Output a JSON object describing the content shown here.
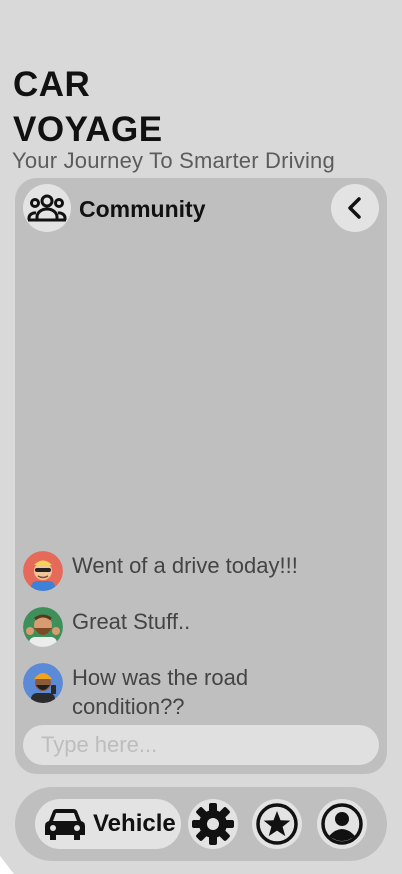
{
  "app": {
    "title_line1": "CAR",
    "title_line2": "VOYAGE",
    "tagline": "Your Journey To Smarter Driving"
  },
  "community": {
    "title": "Community",
    "messages": [
      {
        "text": "Went of a drive today!!!",
        "avatar": "avatar-sunglasses"
      },
      {
        "text": "Great Stuff..",
        "avatar": "avatar-bearded-man"
      },
      {
        "text": "How was the road condition??",
        "avatar": "avatar-turban-man"
      }
    ],
    "input_placeholder": "Type here..."
  },
  "nav": {
    "vehicle_label": "Vehicle",
    "icons": [
      "car-icon",
      "gear-icon",
      "star-icon",
      "profile-icon"
    ]
  },
  "colors": {
    "background": "#d9d9d9",
    "panel": "#bfbfbf",
    "button": "#e3e3e3"
  }
}
